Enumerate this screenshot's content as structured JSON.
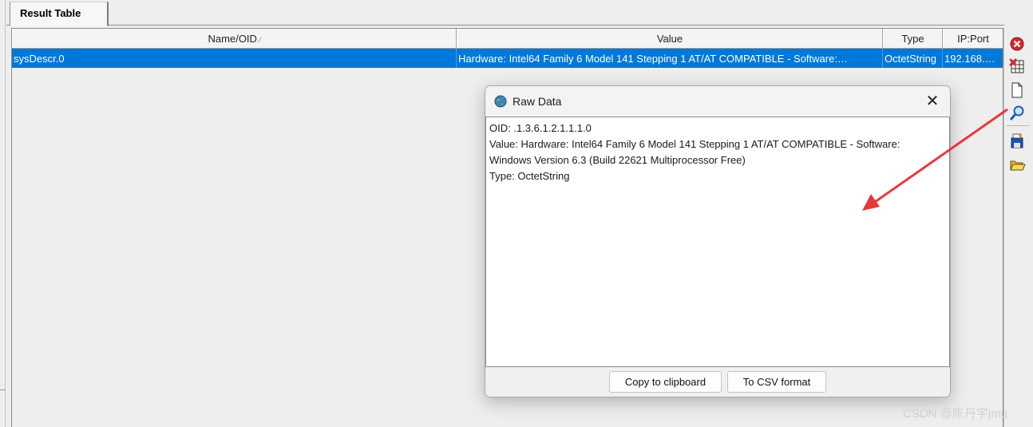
{
  "tab": {
    "label": "Result Table"
  },
  "table": {
    "columns": [
      "Name/OID",
      "Value",
      "Type",
      "IP:Port"
    ],
    "sort_indicator": "⁄",
    "rows": [
      {
        "name": "sysDescr.0",
        "value": "Hardware: Intel64 Family 6 Model 141 Stepping 1 AT/AT COMPATIBLE - Software:…",
        "type": "OctetString",
        "ip_port": "192.168.…"
      }
    ]
  },
  "toolbar": {
    "icons": [
      "close-red-icon",
      "delete-table-icon",
      "new-document-icon",
      "search-icon",
      "save-icon",
      "open-folder-icon"
    ]
  },
  "dialog": {
    "title": "Raw Data",
    "close_glyph": "✕",
    "lines": [
      "OID: .1.3.6.1.2.1.1.1.0",
      "Value: Hardware: Intel64 Family 6 Model 141 Stepping 1 AT/AT COMPATIBLE - Software:",
      "Windows Version 6.3 (Build 22621 Multiprocessor Free)",
      "Type: OctetString"
    ],
    "buttons": {
      "copy": "Copy to clipboard",
      "csv": "To CSV format"
    }
  },
  "watermark": "CSDN @陈丹宇jmu",
  "colors": {
    "selection": "#0078d7",
    "arrow": "#e8393a"
  }
}
